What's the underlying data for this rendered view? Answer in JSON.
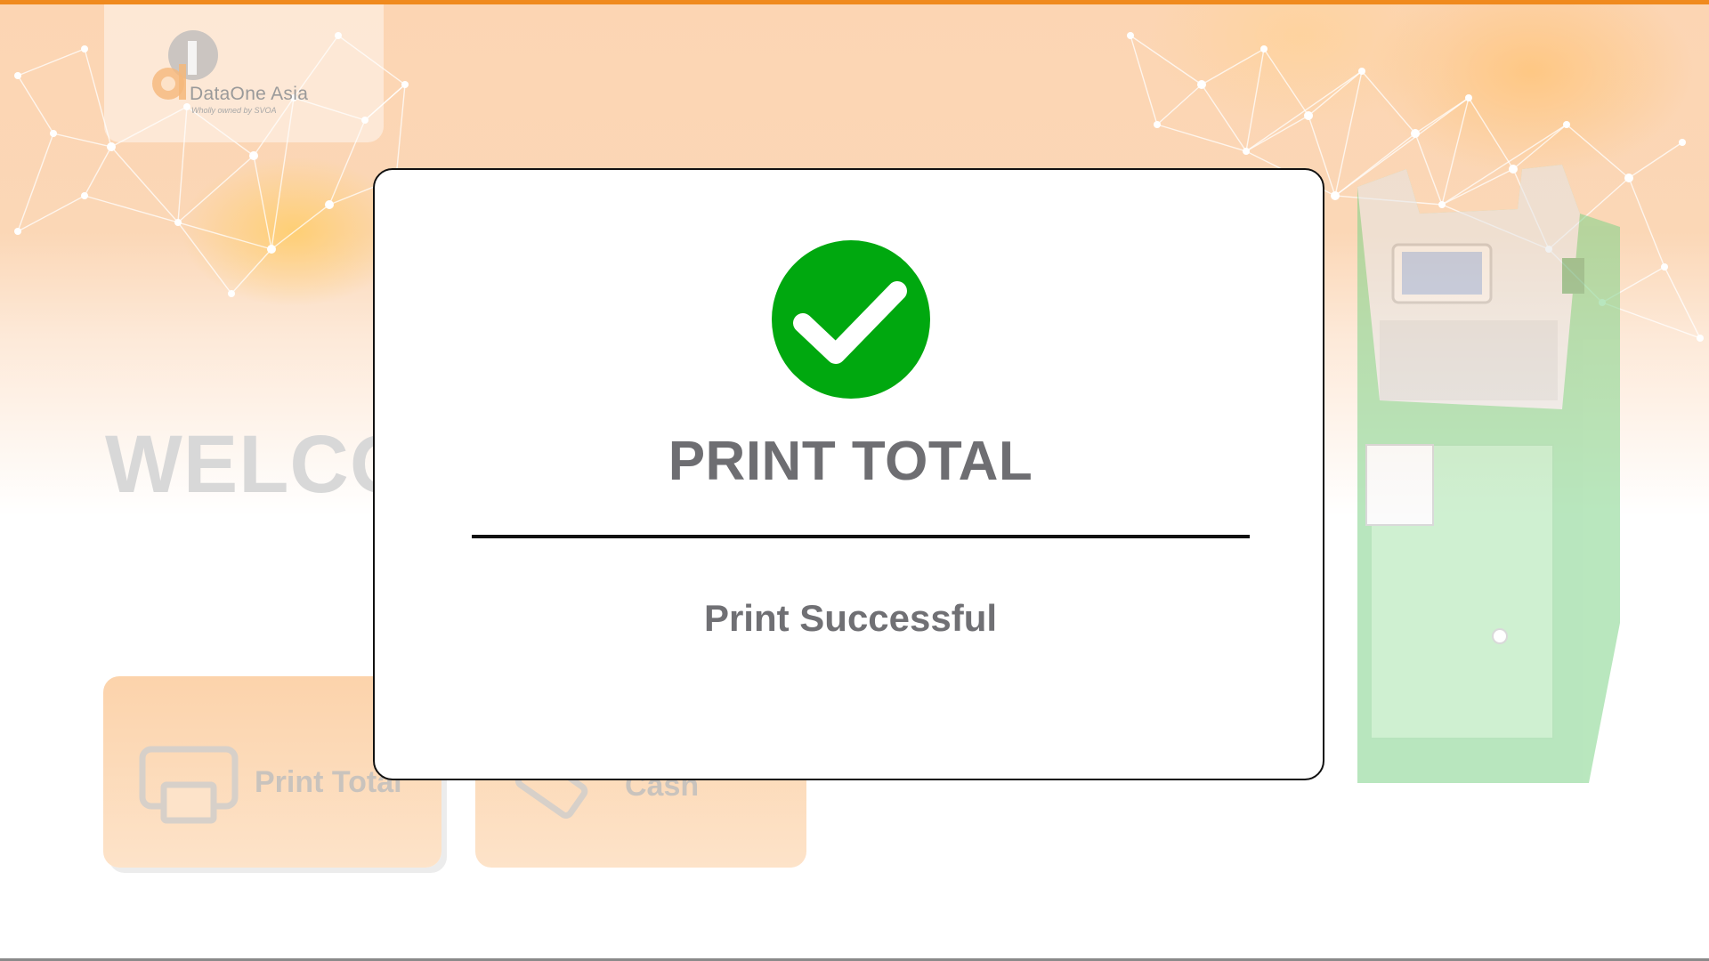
{
  "app": {
    "brand_name": "DataOne Asia",
    "brand_tagline": "Wholly owned by SVOA",
    "welcome_text": "WELCO"
  },
  "actions": {
    "print_total_label": "Print Total",
    "cash_label": "Cash"
  },
  "dialog": {
    "title": "PRINT TOTAL",
    "message": "Print Successful",
    "status_icon": "check-circle-icon",
    "status_color": "#00a80f"
  },
  "colors": {
    "accent": "#f08a1e",
    "header_background": "#fcd5b3",
    "machine_tint": "#9fe3a0"
  }
}
